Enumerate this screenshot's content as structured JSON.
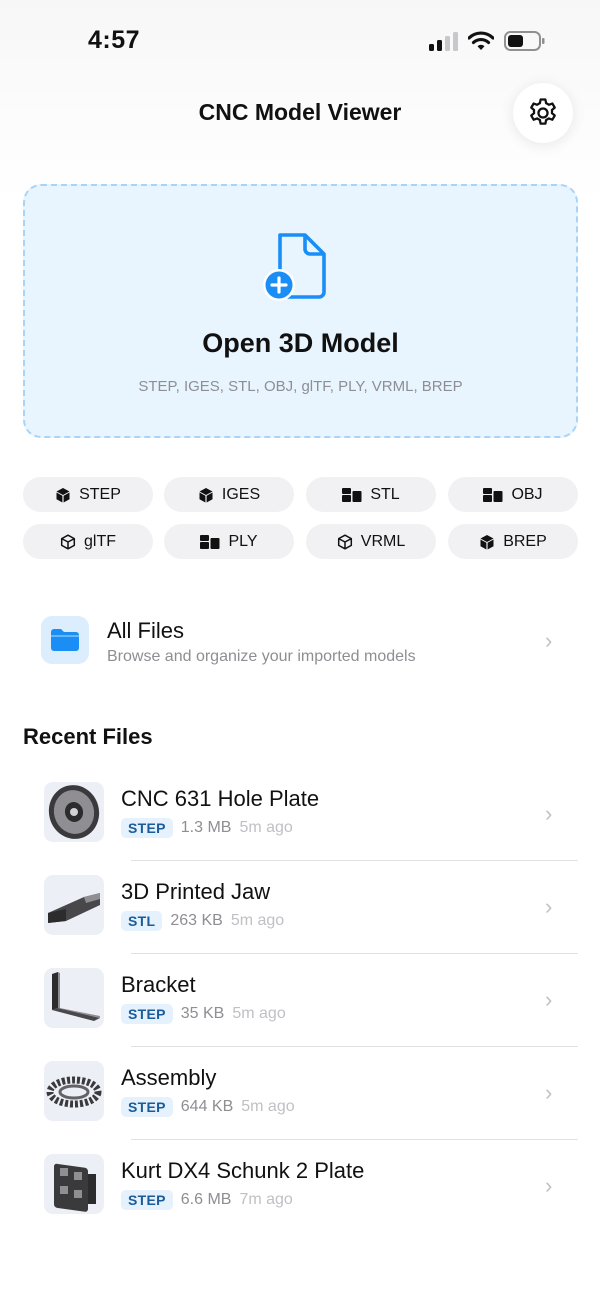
{
  "status_bar": {
    "time": "4:57"
  },
  "header": {
    "title": "CNC Model Viewer"
  },
  "open_card": {
    "title": "Open 3D Model",
    "formats_line": "STEP, IGES, STL, OBJ, glTF, PLY, VRML, BREP"
  },
  "format_chips": [
    {
      "label": "STEP",
      "icon": "cube-solid-icon"
    },
    {
      "label": "IGES",
      "icon": "cube-solid-icon"
    },
    {
      "label": "STL",
      "icon": "blocks-icon"
    },
    {
      "label": "OBJ",
      "icon": "blocks-icon"
    },
    {
      "label": "glTF",
      "icon": "cube-outline-icon"
    },
    {
      "label": "PLY",
      "icon": "blocks-icon"
    },
    {
      "label": "VRML",
      "icon": "cube-outline-icon"
    },
    {
      "label": "BREP",
      "icon": "cube-solid-icon"
    }
  ],
  "all_files": {
    "title": "All Files",
    "subtitle": "Browse and organize your imported models"
  },
  "recent": {
    "title": "Recent Files",
    "items": [
      {
        "name": "CNC 631 Hole Plate",
        "format": "STEP",
        "size": "1.3 MB",
        "ago": "5m ago"
      },
      {
        "name": "3D Printed Jaw",
        "format": "STL",
        "size": "263 KB",
        "ago": "5m ago"
      },
      {
        "name": "Bracket",
        "format": "STEP",
        "size": "35 KB",
        "ago": "5m ago"
      },
      {
        "name": "Assembly",
        "format": "STEP",
        "size": "644 KB",
        "ago": "5m ago"
      },
      {
        "name": "Kurt DX4 Schunk 2 Plate",
        "format": "STEP",
        "size": "6.6 MB",
        "ago": "7m ago"
      }
    ]
  },
  "colors": {
    "accent": "#1a8ef5",
    "card_bg": "#e8f4fe",
    "badge_bg": "#e5f1fd"
  }
}
